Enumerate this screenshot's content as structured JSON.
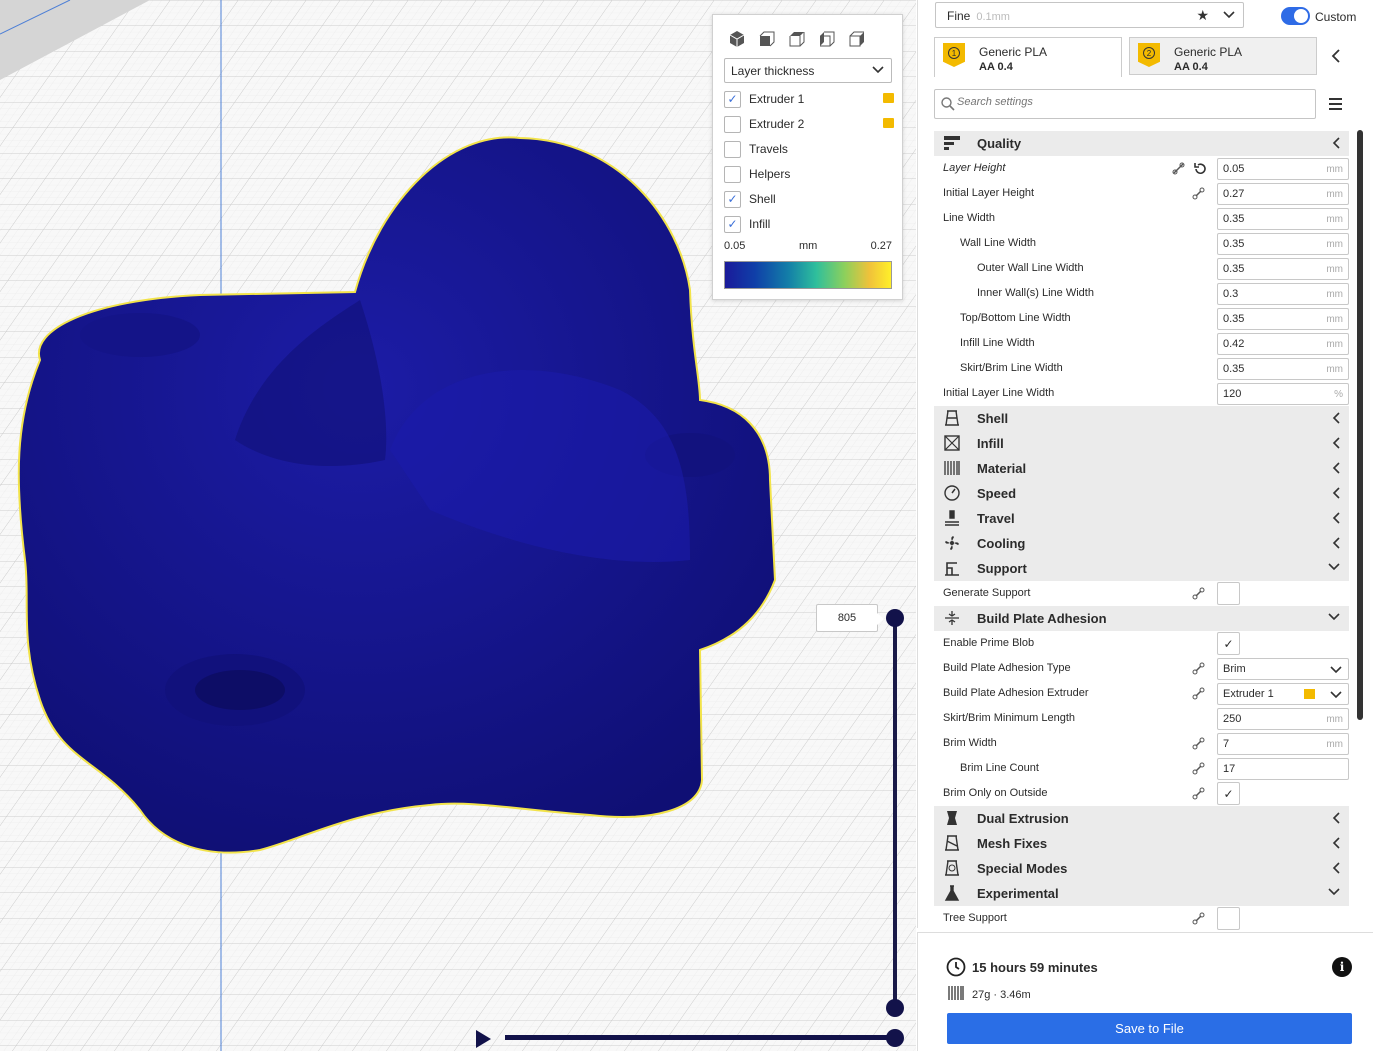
{
  "view_panel": {
    "color_scheme": "Layer thickness",
    "legend": [
      {
        "label": "Extruder 1",
        "checked": true,
        "flag": true
      },
      {
        "label": "Extruder 2",
        "checked": false,
        "flag": true
      },
      {
        "label": "Travels",
        "checked": false,
        "flag": false
      },
      {
        "label": "Helpers",
        "checked": false,
        "flag": false
      },
      {
        "label": "Shell",
        "checked": true,
        "flag": false
      },
      {
        "label": "Infill",
        "checked": true,
        "flag": false
      }
    ],
    "scale_min": "0.05",
    "scale_unit": "mm",
    "scale_max": "0.27"
  },
  "layer_slider": {
    "current_layer": "805"
  },
  "profile": {
    "name": "Fine",
    "layer_height": "0.1mm",
    "mode_label": "Custom",
    "custom_enabled": true
  },
  "extruders": [
    {
      "number": "1",
      "material": "Generic PLA",
      "nozzle": "AA 0.4"
    },
    {
      "number": "2",
      "material": "Generic PLA",
      "nozzle": "AA 0.4"
    }
  ],
  "search": {
    "placeholder": "Search settings"
  },
  "categories": {
    "quality": "Quality",
    "shell": "Shell",
    "infill": "Infill",
    "material": "Material",
    "speed": "Speed",
    "travel": "Travel",
    "cooling": "Cooling",
    "support": "Support",
    "adhesion": "Build Plate Adhesion",
    "dual": "Dual Extrusion",
    "mesh": "Mesh Fixes",
    "special": "Special Modes",
    "experimental": "Experimental"
  },
  "quality_settings": [
    {
      "label": "Layer Height",
      "value": "0.05",
      "unit": "mm"
    },
    {
      "label": "Initial Layer Height",
      "value": "0.27",
      "unit": "mm"
    },
    {
      "label": "Line Width",
      "value": "0.35",
      "unit": "mm"
    },
    {
      "label": "Wall Line Width",
      "value": "0.35",
      "unit": "mm"
    },
    {
      "label": "Outer Wall Line Width",
      "value": "0.35",
      "unit": "mm"
    },
    {
      "label": "Inner Wall(s) Line Width",
      "value": "0.3",
      "unit": "mm"
    },
    {
      "label": "Top/Bottom Line Width",
      "value": "0.35",
      "unit": "mm"
    },
    {
      "label": "Infill Line Width",
      "value": "0.42",
      "unit": "mm"
    },
    {
      "label": "Skirt/Brim Line Width",
      "value": "0.35",
      "unit": "mm"
    },
    {
      "label": "Initial Layer Line Width",
      "value": "120",
      "unit": "%"
    }
  ],
  "support_settings": {
    "generate_support": {
      "label": "Generate Support",
      "checked": false
    }
  },
  "adhesion_settings": {
    "prime_blob": {
      "label": "Enable Prime Blob",
      "checked": true
    },
    "type": {
      "label": "Build Plate Adhesion Type",
      "value": "Brim"
    },
    "extruder": {
      "label": "Build Plate Adhesion Extruder",
      "value": "Extruder 1"
    },
    "min_length": {
      "label": "Skirt/Brim Minimum Length",
      "value": "250",
      "unit": "mm"
    },
    "brim_width": {
      "label": "Brim Width",
      "value": "7",
      "unit": "mm"
    },
    "brim_lines": {
      "label": "Brim Line Count",
      "value": "17"
    },
    "brim_outside": {
      "label": "Brim Only on Outside",
      "checked": true
    }
  },
  "experimental_settings": {
    "tree_support": {
      "label": "Tree Support",
      "checked": false
    }
  },
  "print_info": {
    "time": "15 hours 59 minutes",
    "material_usage": "27g · 3.46m",
    "save_label": "Save to File"
  },
  "colors": {
    "accent": "#2a6ee6",
    "model": "#1a1a9a",
    "extruder_flag": "#f3ba00"
  }
}
